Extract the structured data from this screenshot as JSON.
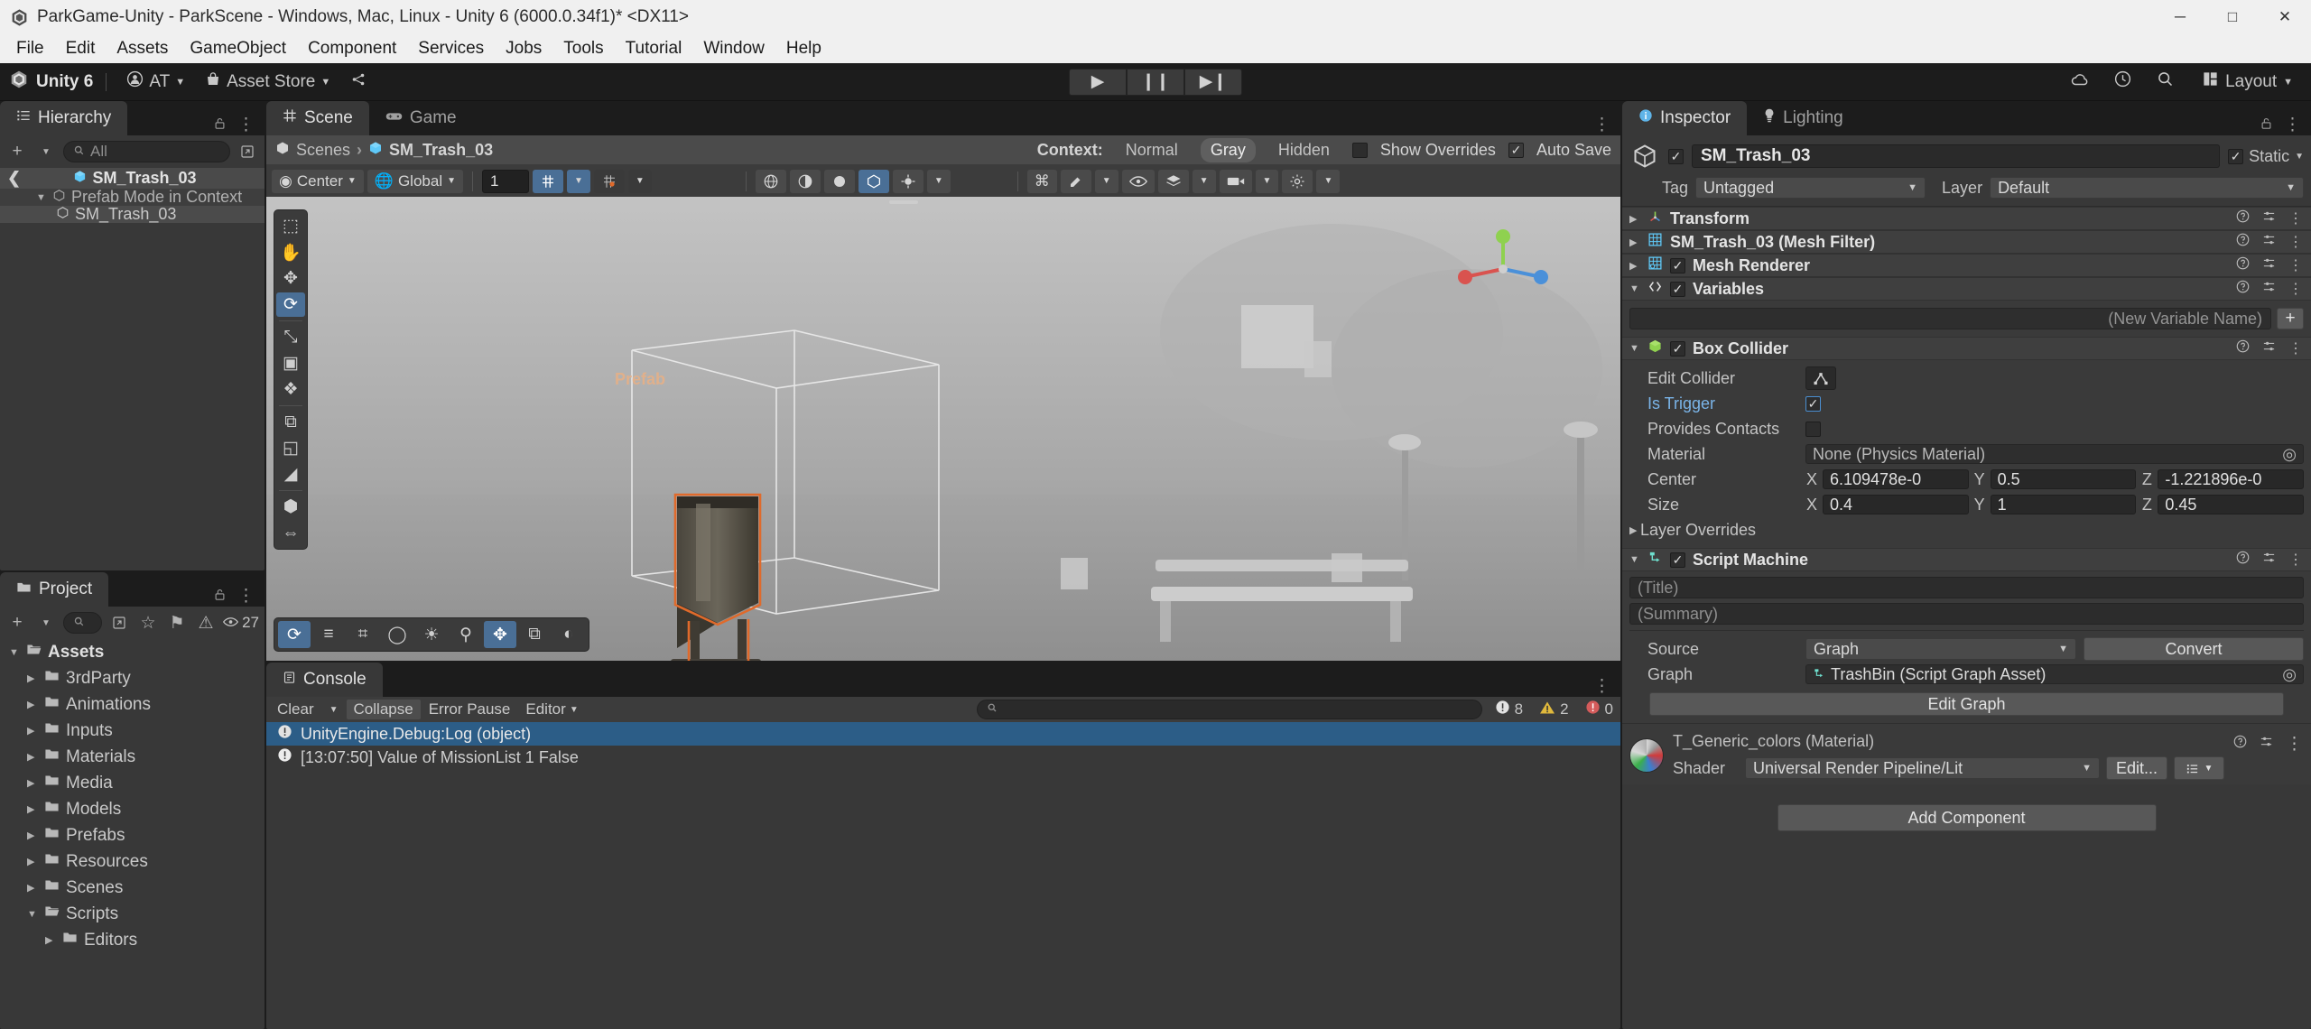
{
  "window": {
    "title": "ParkGame-Unity - ParkScene - Windows, Mac, Linux - Unity 6 (6000.0.34f1)* <DX11>",
    "minimize": "─",
    "maximize": "□",
    "close": "✕"
  },
  "menu": [
    "File",
    "Edit",
    "Assets",
    "GameObject",
    "Component",
    "Services",
    "Jobs",
    "Tools",
    "Tutorial",
    "Window",
    "Help"
  ],
  "toolbar": {
    "unity_label": "Unity 6",
    "account": "AT",
    "asset_store": "Asset Store",
    "play": "▶",
    "pause": "❙❙",
    "step": "▶❙",
    "layout": "Layout",
    "cloud_icon": "cloud-icon",
    "history_icon": "history-icon",
    "search_icon": "search-icon"
  },
  "hierarchy": {
    "tab": "Hierarchy",
    "search_placeholder": "All",
    "selected_prefab": "SM_Trash_03",
    "rows": [
      {
        "label": "Prefab Mode in Context",
        "indent": 1,
        "arrow": "▼",
        "icon": "prefab-icon"
      },
      {
        "label": "SM_Trash_03",
        "indent": 2,
        "arrow": "",
        "icon": "prefab-icon"
      }
    ]
  },
  "project": {
    "tab": "Project",
    "search_placeholder": "",
    "visible_count": "27",
    "rows": [
      {
        "label": "Assets",
        "indent": 0,
        "arrow": "▼",
        "open": true
      },
      {
        "label": "3rdParty",
        "indent": 1,
        "arrow": "▶",
        "open": false
      },
      {
        "label": "Animations",
        "indent": 1,
        "arrow": "▶",
        "open": false
      },
      {
        "label": "Inputs",
        "indent": 1,
        "arrow": "▶",
        "open": false
      },
      {
        "label": "Materials",
        "indent": 1,
        "arrow": "▶",
        "open": false
      },
      {
        "label": "Media",
        "indent": 1,
        "arrow": "▶",
        "open": false
      },
      {
        "label": "Models",
        "indent": 1,
        "arrow": "▶",
        "open": false
      },
      {
        "label": "Prefabs",
        "indent": 1,
        "arrow": "▶",
        "open": false
      },
      {
        "label": "Resources",
        "indent": 1,
        "arrow": "▶",
        "open": false
      },
      {
        "label": "Scenes",
        "indent": 1,
        "arrow": "▶",
        "open": false
      },
      {
        "label": "Scripts",
        "indent": 1,
        "arrow": "▼",
        "open": true
      },
      {
        "label": "Editors",
        "indent": 2,
        "arrow": "▶",
        "open": false
      }
    ]
  },
  "scene": {
    "tabs": [
      {
        "label": "Scene",
        "active": true,
        "icon": "grid-icon"
      },
      {
        "label": "Game",
        "active": false,
        "icon": "gamepad-icon"
      }
    ],
    "breadcrumb_root": "Scenes",
    "breadcrumb_current": "SM_Trash_03",
    "context_label": "Context:",
    "context_options": [
      "Normal",
      "Gray",
      "Hidden"
    ],
    "context_selected": "Gray",
    "show_overrides": "Show Overrides",
    "auto_save": "Auto Save",
    "show_overrides_checked": false,
    "auto_save_checked": true,
    "pivot_mode": "Center",
    "handle_space": "Global",
    "grid_size": "1",
    "prefab_watermark": "Prefab",
    "left_tools": [
      {
        "name": "view-tool-icon",
        "glyph": "⬚",
        "active": false
      },
      {
        "name": "hand-tool-icon",
        "glyph": "✋",
        "active": false
      },
      {
        "name": "move-tool-icon",
        "glyph": "✥",
        "active": false
      },
      {
        "name": "rotate-tool-icon",
        "glyph": "⟳",
        "active": true
      },
      {
        "name": "scale-tool-icon",
        "glyph": "⤡",
        "active": false
      },
      {
        "name": "rect-tool-icon",
        "glyph": "▣",
        "active": false
      },
      {
        "name": "transform-tool-icon",
        "glyph": "❖",
        "active": false
      },
      {
        "name": "custom-tool-icon",
        "glyph": "⧉",
        "active": false
      },
      {
        "name": "collider-edit-icon",
        "glyph": "◱",
        "active": false
      },
      {
        "name": "mesh-edit-icon",
        "glyph": "◢",
        "active": false
      },
      {
        "name": "snap-tool-icon",
        "glyph": "⬢",
        "active": false
      },
      {
        "name": "polybrush-icon",
        "glyph": "⇔",
        "active": false
      }
    ],
    "bottom_tools": [
      {
        "name": "orbit-icon",
        "glyph": "⟳",
        "active": true
      },
      {
        "name": "align-icon",
        "glyph": "≡",
        "active": false
      },
      {
        "name": "grid-snap-icon",
        "glyph": "⌗",
        "active": false
      },
      {
        "name": "sphere-icon",
        "glyph": "◯",
        "active": false
      },
      {
        "name": "lighting-icon",
        "glyph": "☀",
        "active": false
      },
      {
        "name": "zoom-icon",
        "glyph": "⚲",
        "active": false
      },
      {
        "name": "move-icon",
        "glyph": "✥",
        "active": true
      },
      {
        "name": "copy-icon",
        "glyph": "⧉",
        "active": false
      },
      {
        "name": "audio-icon",
        "glyph": "◐",
        "active": false
      }
    ]
  },
  "console": {
    "tab": "Console",
    "clear": "Clear",
    "collapse": "Collapse",
    "error_pause": "Error Pause",
    "editor": "Editor",
    "search_placeholder": "",
    "counts": {
      "log": "8",
      "warning": "2",
      "error": "0"
    },
    "rows": [
      {
        "text": "UnityEngine.Debug:Log (object)",
        "selected": true,
        "icon": "log-icon"
      },
      {
        "text": "[13:07:50] Value of MissionList 1 False",
        "selected": false,
        "icon": "warning-icon"
      }
    ]
  },
  "inspector": {
    "tabs": [
      {
        "label": "Inspector",
        "active": true,
        "icon": "info-icon"
      },
      {
        "label": "Lighting",
        "active": false,
        "icon": "bulb-icon"
      }
    ],
    "object_name": "SM_Trash_03",
    "enabled": true,
    "static_label": "Static",
    "static_checked": true,
    "tag_label": "Tag",
    "tag_value": "Untagged",
    "layer_label": "Layer",
    "layer_value": "Default",
    "components": [
      {
        "name": "Transform",
        "icon": "transform-icon",
        "has_toggle": false,
        "checked": false,
        "expanded": false
      },
      {
        "name": "SM_Trash_03 (Mesh Filter)",
        "icon": "meshfilter-icon",
        "has_toggle": false,
        "checked": false,
        "expanded": false
      },
      {
        "name": "Mesh Renderer",
        "icon": "meshrenderer-icon",
        "has_toggle": true,
        "checked": true,
        "expanded": false
      },
      {
        "name": "Variables",
        "icon": "variables-icon",
        "has_toggle": true,
        "checked": true,
        "expanded": true
      }
    ],
    "variables": {
      "new_variable_placeholder": "(New Variable Name)",
      "add_button": "+"
    },
    "box_collider": {
      "name": "Box Collider",
      "checked": true,
      "edit_collider_label": "Edit Collider",
      "is_trigger_label": "Is Trigger",
      "is_trigger": true,
      "provides_contacts_label": "Provides Contacts",
      "provides_contacts": false,
      "material_label": "Material",
      "material_value": "None (Physics Material)",
      "center_label": "Center",
      "center": {
        "x": "6.109478e-0",
        "y": "0.5",
        "z": "-1.221896e-0"
      },
      "size_label": "Size",
      "size": {
        "x": "0.4",
        "y": "1",
        "z": "0.45"
      },
      "layer_overrides_label": "Layer Overrides"
    },
    "script_machine": {
      "name": "Script Machine",
      "checked": true,
      "title_placeholder": "(Title)",
      "summary_placeholder": "(Summary)",
      "source_label": "Source",
      "source_value": "Graph",
      "convert_button": "Convert",
      "graph_label": "Graph",
      "graph_value": "TrashBin (Script Graph Asset)",
      "edit_graph_button": "Edit Graph"
    },
    "material": {
      "name": "T_Generic_colors (Material)",
      "shader_label": "Shader",
      "shader_value": "Universal Render Pipeline/Lit",
      "edit_button": "Edit..."
    },
    "add_component": "Add Component"
  },
  "colors": {
    "accent_blue": "#4a6f96",
    "selection_blue": "#2c5d87",
    "panel_bg": "#383838",
    "toolbar_bg": "#1c1c1c",
    "prefab_cyan": "#5fc9f8",
    "highlight_orange": "#e06a2b"
  }
}
